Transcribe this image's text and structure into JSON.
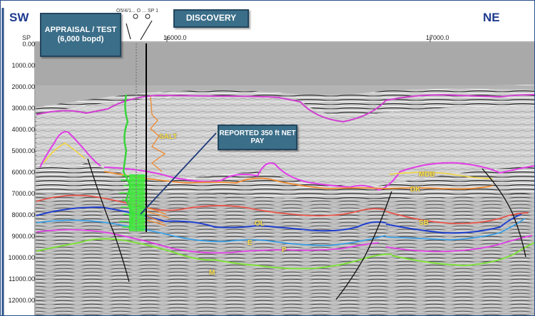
{
  "header": {
    "left_direction": "SW",
    "right_direction": "NE",
    "sp_label": "SP",
    "well_names": "O5/4/1... O ... SP 1"
  },
  "x_ticks": [
    "16000.0",
    "17000.0"
  ],
  "y_ticks": [
    "0.00",
    "1000.00",
    "2000.00",
    "3000.00",
    "4000.00",
    "5000.00",
    "6000.00",
    "7000.00",
    "8000.00",
    "9000.00",
    "10000.00",
    "11000.00",
    "12000.00"
  ],
  "callouts": {
    "appraisal": "APPRAISAL / TEST (6,000 bopd)",
    "discovery": "DISCOVERY",
    "reported": "REPORTED 350 ft NET PAY"
  },
  "horizon_labels": {
    "salt": "SALT",
    "mdb": "MDB",
    "dk": "DK",
    "sb": "SB",
    "ol": "OL",
    "e": "E",
    "p": "P",
    "m": "M"
  },
  "colors": {
    "salt_top": "#d23cd2",
    "magenta": "#e13ce6",
    "orange": "#f08a30",
    "yellow": "#f2d640",
    "red": "#e8544a",
    "blue": "#1f3fd0",
    "lightblue": "#3aa0e6",
    "green": "#7ee03a",
    "callout_bg": "#3b6e89"
  }
}
